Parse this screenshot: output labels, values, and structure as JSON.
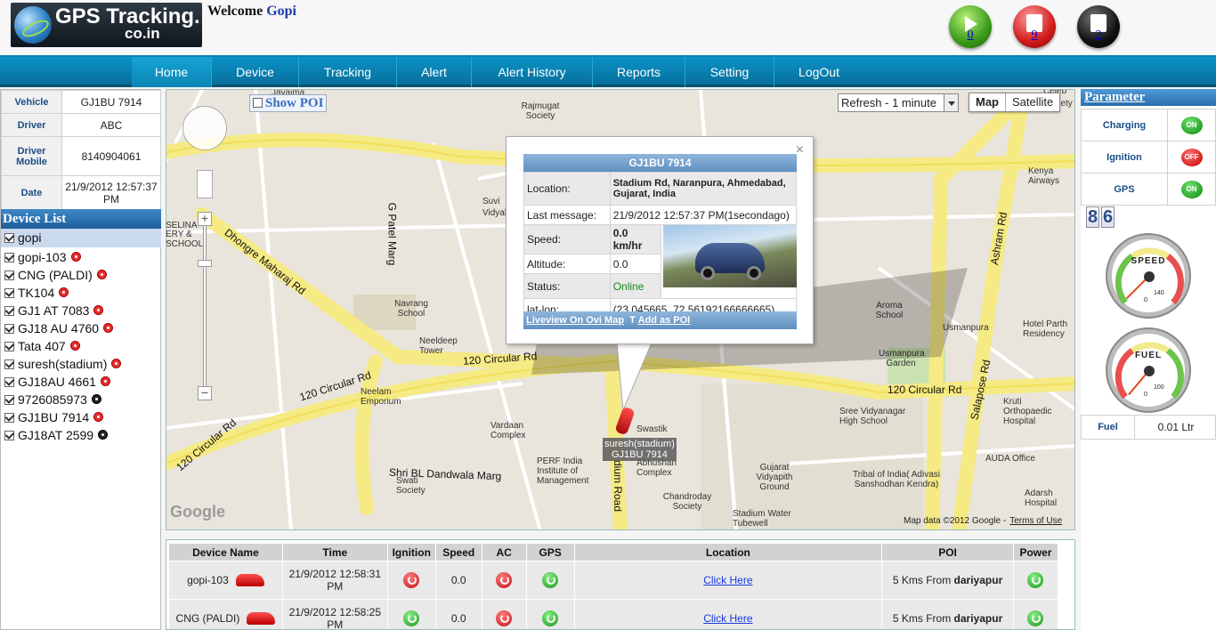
{
  "header": {
    "logo_text_main": "GPS Tracking.",
    "logo_text_sub": "co.in",
    "welcome_label": "Welcome",
    "welcome_user": "Gopi",
    "counters": [
      {
        "name": "running",
        "value": "0",
        "color": "#3b9b18"
      },
      {
        "name": "stopped",
        "value": "9",
        "color": "#d11b1b"
      },
      {
        "name": "offline",
        "value": "2",
        "color": "#111111"
      }
    ]
  },
  "nav": {
    "items": [
      "Home",
      "Device",
      "Tracking",
      "Alert",
      "Alert History",
      "Reports",
      "Setting",
      "LogOut"
    ],
    "active": "Home"
  },
  "vehicle_info": {
    "vehicle_label": "Vehicle",
    "vehicle": "GJ1BU 7914",
    "driver_label": "Driver",
    "driver": "ABC",
    "driver_mobile_label": "Driver Mobile",
    "driver_mobile": "8140904061",
    "date_label": "Date",
    "date": "21/9/2012 12:57:37 PM"
  },
  "device_list": {
    "title": "Device List",
    "group": "gopi",
    "devices": [
      {
        "name": "gopi-103",
        "status": "red"
      },
      {
        "name": "CNG (PALDI)",
        "status": "red"
      },
      {
        "name": "TK104",
        "status": "red"
      },
      {
        "name": "GJ1 AT 7083",
        "status": "red"
      },
      {
        "name": "GJ18 AU 4760",
        "status": "red"
      },
      {
        "name": "Tata 407",
        "status": "red"
      },
      {
        "name": "suresh(stadium)",
        "status": "red"
      },
      {
        "name": "GJ18AU 4661",
        "status": "red"
      },
      {
        "name": "9726085973",
        "status": "black"
      },
      {
        "name": "GJ1BU 7914",
        "status": "red"
      },
      {
        "name": "GJ18AT 2599",
        "status": "black"
      }
    ]
  },
  "map": {
    "show_poi": "Show POI",
    "refresh": "Refresh - 1 minute",
    "type_map": "Map",
    "type_satellite": "Satellite",
    "google": "Google",
    "attribution": "Map data ©2012 Google -",
    "terms": "Terms of Use",
    "labels": [
      "Jayaima",
      "Rajmugat Society",
      "Celeb",
      "Society",
      "Kenya Airways",
      "SELINA",
      "ERY &",
      "SCHOOL",
      "Suvi",
      "Vidyala",
      "Navrang School",
      "Neeldeep Tower",
      "Neelam Emporium",
      "Vardaan Complex",
      "PERF India Institute of Management",
      "Swati Society",
      "Swastik",
      "Abhushan Complex",
      "Chandroday Society",
      "Stadium Water Tubewell",
      "Gujarat Vidyapith Ground",
      "AUDA Office",
      "Tribal of India( Adivasi Sanshodhan Kendra)",
      "Sree Vidyanagar High School",
      "Kruti Orthopaedic Hospital",
      "Adarsh Hospital",
      "Aroma School",
      "Usmanpura",
      "Usmanpura Garden",
      "Hotel Parth Residency"
    ],
    "roads": [
      "Dhongre Maharaj Rd",
      "G Patel Marg",
      "120 Circular Rd",
      "120 Circular Rd",
      "120 Circular Rd",
      "120 Circular Rd",
      "Ashram Rd",
      "Salapose Rd",
      "Shri BL Dandwala Marg",
      "dium Road"
    ],
    "car_label_1": "suresh(stadium)",
    "car_label_2": "GJ1BU 7914"
  },
  "popup": {
    "title": "GJ1BU 7914",
    "location_label": "Location:",
    "location": "Stadium Rd, Naranpura, Ahmedabad, Gujarat, India",
    "last_message_label": "Last message:",
    "last_message": "21/9/2012 12:57:37 PM(1secondago)",
    "speed_label": "Speed:",
    "speed": "0.0 km/hr",
    "altitude_label": "Altitude:",
    "altitude": "0.0",
    "status_label": "Status:",
    "status": "Online",
    "status_color": "#1a8a1a",
    "latlon_label": "lat-lon:",
    "latlon": "(23.045665, 72.56192166666665)",
    "liveview": "Liveview On Ovi Map",
    "add_poi": "Add as POI",
    "close": "×"
  },
  "parameters": {
    "title": "Parameter",
    "rows": [
      {
        "label": "Charging",
        "state": "ON"
      },
      {
        "label": "Ignition",
        "state": "OFF"
      },
      {
        "label": "GPS",
        "state": "ON"
      }
    ],
    "odometer": [
      "8",
      "6"
    ],
    "speed_gauge": {
      "label": "SPEED",
      "min": "0",
      "max": "140",
      "value": 0
    },
    "fuel_gauge": {
      "label": "FUEL",
      "min": "0",
      "max": "100",
      "value": 0
    },
    "fuel_label": "Fuel",
    "fuel_value": "0.01 Ltr"
  },
  "table": {
    "headers": [
      "Device Name",
      "Time",
      "Ignition",
      "Speed",
      "AC",
      "GPS",
      "Location",
      "POI",
      "Power"
    ],
    "rows": [
      {
        "device": "gopi-103",
        "time": "21/9/2012 12:58:31 PM",
        "ignition": "red",
        "speed": "0.0",
        "ac": "red",
        "gps": "green",
        "location": "Click Here",
        "poi_prefix": "5 Kms From",
        "poi_place": "dariyapur",
        "power": "green"
      },
      {
        "device": "CNG (PALDI)",
        "time": "21/9/2012 12:58:25 PM",
        "ignition": "green",
        "speed": "0.0",
        "ac": "red",
        "gps": "green",
        "location": "Click Here",
        "poi_prefix": "5 Kms From",
        "poi_place": "dariyapur",
        "power": "green"
      }
    ]
  }
}
